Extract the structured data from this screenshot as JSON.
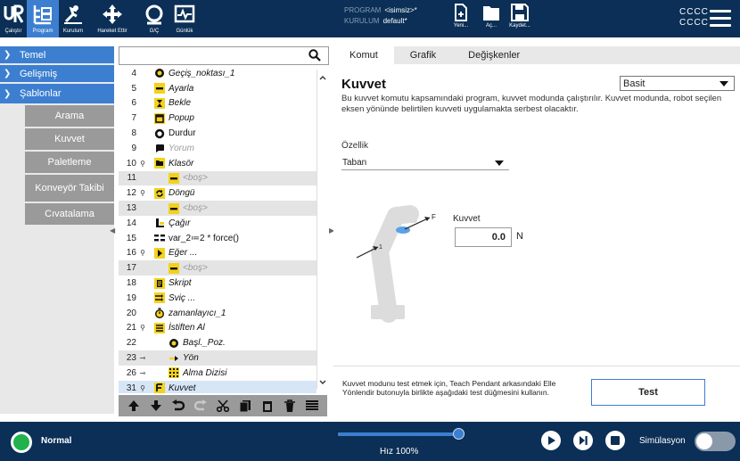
{
  "topbar": {
    "tools": [
      {
        "label": "Çalıştır",
        "icon": "ur-logo-icon"
      },
      {
        "label": "Program",
        "icon": "program-tree-icon",
        "active": true
      },
      {
        "label": "Kurulum",
        "icon": "install-icon"
      },
      {
        "label": "Hareket Ettir",
        "icon": "move-icon"
      },
      {
        "label": "G/Ç",
        "icon": "io-icon"
      },
      {
        "label": "Günlük",
        "icon": "log-icon"
      }
    ],
    "program_label": "PROGRAM",
    "program_value": "<isimsiz>*",
    "install_label": "KURULUM",
    "install_value": "default*",
    "file": {
      "new_label": "Yeni...",
      "open_label": "Aç...",
      "save_label": "Kaydet..."
    },
    "user_line1": "CCCC",
    "user_line2": "CCCC"
  },
  "leftnav": {
    "basic": "Temel",
    "advanced": "Gelişmiş",
    "templates": "Şablonlar",
    "items": [
      "Arama",
      "Kuvvet",
      "Paletleme",
      "Konveyör Takibi",
      "Cıvatalama"
    ]
  },
  "tree": {
    "rows": [
      {
        "n": "4",
        "pin": "",
        "ind": 1,
        "icon": "waypoint",
        "text": "Geçiş_noktası_1",
        "style": "italic",
        "bg": ""
      },
      {
        "n": "5",
        "pin": "",
        "ind": 1,
        "icon": "dash",
        "text": "Ayarla",
        "style": "italic",
        "bg": ""
      },
      {
        "n": "6",
        "pin": "",
        "ind": 1,
        "icon": "hourglass",
        "text": "Bekle",
        "style": "italic",
        "bg": ""
      },
      {
        "n": "7",
        "pin": "",
        "ind": 1,
        "icon": "popup",
        "text": "Popup",
        "style": "italic",
        "bg": ""
      },
      {
        "n": "8",
        "pin": "",
        "ind": 1,
        "icon": "stop",
        "text": "Durdur",
        "style": "normal",
        "bg": ""
      },
      {
        "n": "9",
        "pin": "",
        "ind": 1,
        "icon": "comment",
        "text": "Yorum",
        "style": "dim",
        "bg": ""
      },
      {
        "n": "10",
        "pin": "⚲",
        "ind": 1,
        "icon": "folder",
        "text": "Klasör",
        "style": "italic",
        "bg": ""
      },
      {
        "n": "11",
        "pin": "",
        "ind": 2,
        "icon": "dash",
        "text": "<boş>",
        "style": "dim",
        "bg": "gray"
      },
      {
        "n": "12",
        "pin": "⚲",
        "ind": 1,
        "icon": "loop",
        "text": "Döngü",
        "style": "italic",
        "bg": ""
      },
      {
        "n": "13",
        "pin": "",
        "ind": 2,
        "icon": "dash",
        "text": "<boş>",
        "style": "dim",
        "bg": "gray"
      },
      {
        "n": "14",
        "pin": "",
        "ind": 1,
        "icon": "call",
        "text": "Çağır",
        "style": "italic",
        "bg": ""
      },
      {
        "n": "15",
        "pin": "",
        "ind": 1,
        "icon": "assign",
        "text": "var_2≔2 * force()",
        "style": "normal",
        "bg": ""
      },
      {
        "n": "16",
        "pin": "⚲",
        "ind": 1,
        "icon": "if",
        "text": "Eğer ...",
        "style": "italic",
        "bg": ""
      },
      {
        "n": "17",
        "pin": "",
        "ind": 2,
        "icon": "dash",
        "text": "<boş>",
        "style": "dim",
        "bg": "gray"
      },
      {
        "n": "18",
        "pin": "",
        "ind": 1,
        "icon": "script",
        "text": "Skript",
        "style": "italic",
        "bg": ""
      },
      {
        "n": "19",
        "pin": "",
        "ind": 1,
        "icon": "switch",
        "text": "Sviç ...",
        "style": "italic",
        "bg": ""
      },
      {
        "n": "20",
        "pin": "",
        "ind": 1,
        "icon": "timer",
        "text": "zamanlayıcı_1",
        "style": "italic",
        "bg": ""
      },
      {
        "n": "21",
        "pin": "⚲",
        "ind": 1,
        "icon": "stack",
        "text": "İstiften Al",
        "style": "italic",
        "bg": ""
      },
      {
        "n": "22",
        "pin": "",
        "ind": 2,
        "icon": "waypoint",
        "text": "Başl._Poz.",
        "style": "italic",
        "bg": ""
      },
      {
        "n": "23",
        "pin": "⊸",
        "ind": 2,
        "icon": "direction",
        "text": "Yön",
        "style": "italic",
        "bg": "gray"
      },
      {
        "n": "26",
        "pin": "⊸",
        "ind": 2,
        "icon": "grid",
        "text": "Alma Dizisi",
        "style": "italic",
        "bg": ""
      },
      {
        "n": "31",
        "pin": "⚲",
        "ind": 1,
        "icon": "force",
        "text": "Kuvvet",
        "style": "italic",
        "bg": "sel"
      }
    ]
  },
  "panel": {
    "tabs": [
      "Komut",
      "Grafik",
      "Değişkenler"
    ],
    "title": "Kuvvet",
    "mode_value": "Basit",
    "description": "Bu kuvvet komutu kapsamındaki program, kuvvet modunda çalıştırılır. Kuvvet modunda, robot seçilen eksen yönünde belirtilen kuvveti uygulamakta serbest olacaktır.",
    "feature_label": "Özellik",
    "feature_value": "Taban",
    "axis_f": "F",
    "axis_1": "1",
    "force_label": "Kuvvet",
    "force_value": "0.0",
    "force_unit": "N",
    "test_help": "Kuvvet modunu test etmek için, Teach Pendant arkasındaki Elle Yönlendir butonuyla birlikte aşağıdaki test düğmesini kullanın.",
    "test_label": "Test"
  },
  "bottombar": {
    "status": "Normal",
    "speed_label": "Hız 100%",
    "speed_fraction": 1.0,
    "sim_label": "Simülasyon"
  },
  "colors": {
    "navy": "#0b2f56",
    "accent": "#3c7fd0",
    "yellow": "#f3d21b",
    "ok": "#22b14c"
  }
}
